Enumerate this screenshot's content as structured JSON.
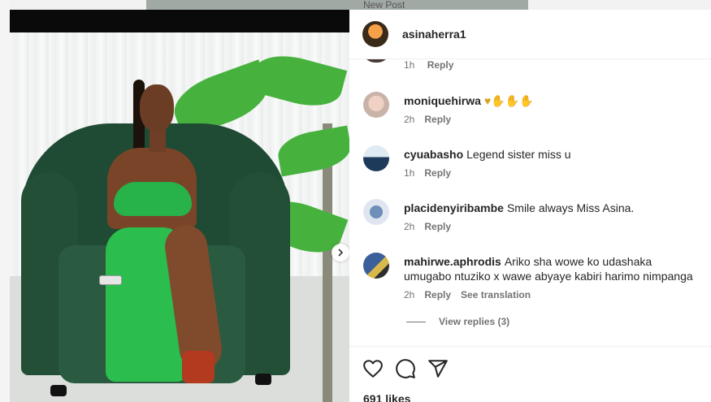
{
  "background": {
    "peek_text": "New Post"
  },
  "header": {
    "username": "asinaherra1"
  },
  "previous_comment": {
    "time": "1h",
    "reply_label": "Reply"
  },
  "comments": [
    {
      "username": "moniquehirwa",
      "text": "♥✋✋✋",
      "time": "2h",
      "reply_label": "Reply"
    },
    {
      "username": "cyuabasho",
      "text": "Legend sister miss u",
      "time": "1h",
      "reply_label": "Reply"
    },
    {
      "username": "placidenyiribambe",
      "text": "Smile always Miss Asina.",
      "time": "2h",
      "reply_label": "Reply"
    },
    {
      "username": "mahirwe.aphrodis",
      "text": "Ariko sha wowe ko udashaka umugabo ntuziko x wawe abyaye kabiri harimo nimpanga",
      "time": "2h",
      "reply_label": "Reply",
      "translation_label": "See translation"
    }
  ],
  "view_replies": "View replies (3)",
  "actions": {
    "icons": [
      "heart-icon",
      "comment-icon",
      "share-icon"
    ]
  },
  "likes": "691 likes",
  "colors": {
    "text": "#262626",
    "muted": "#737373",
    "heart": "#ed4956",
    "dress": "#2bbd4d"
  }
}
